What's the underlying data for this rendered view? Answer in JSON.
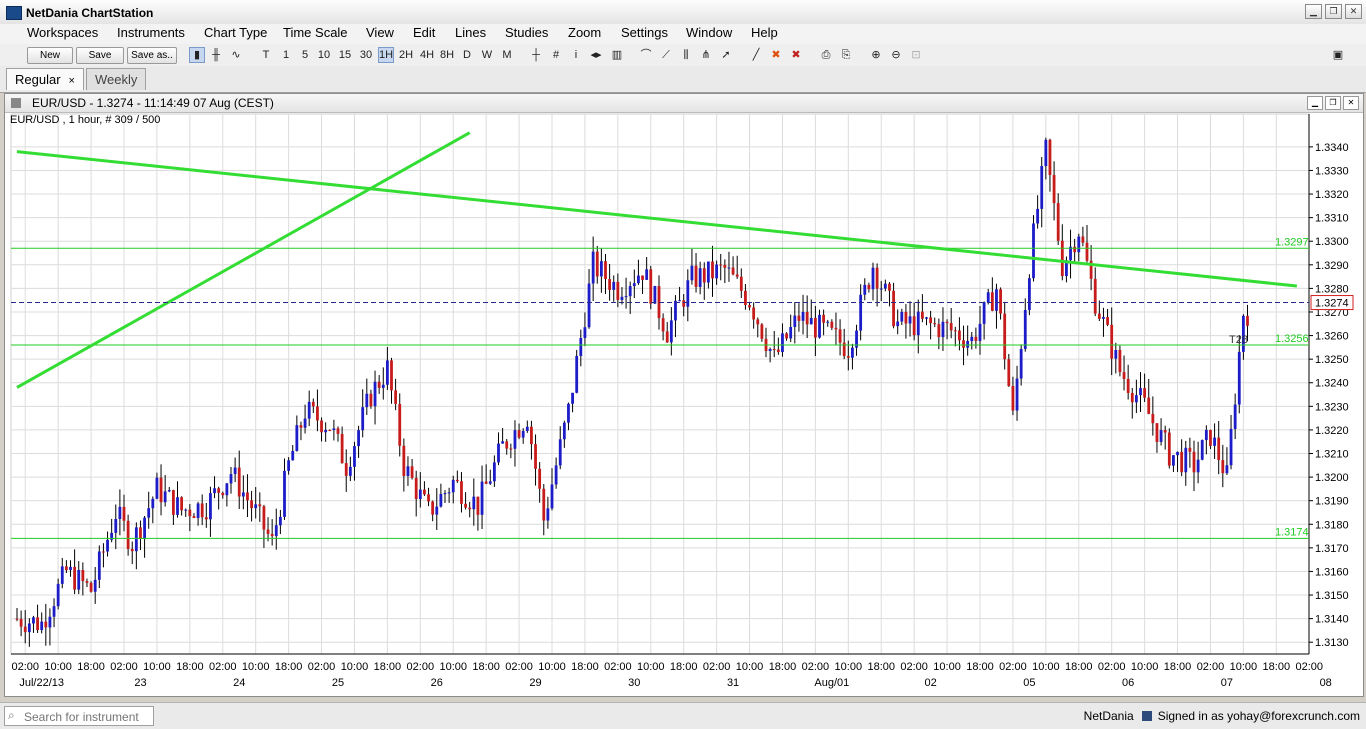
{
  "app": {
    "title": "NetDania ChartStation"
  },
  "menus": [
    "Workspaces",
    "Instruments",
    "Chart Type",
    "Time Scale",
    "View",
    "Edit",
    "Lines",
    "Studies",
    "Zoom",
    "Settings",
    "Window",
    "Help"
  ],
  "toolbar": {
    "new_label": "New",
    "save_label": "Save",
    "save_as_label": "Save as..",
    "timeframes": [
      "T",
      "1",
      "5",
      "10",
      "15",
      "30",
      "1H",
      "2H",
      "4H",
      "8H",
      "D",
      "W",
      "M"
    ],
    "selected_timeframe": "1H"
  },
  "tabs": [
    {
      "label": "Regular",
      "active": true,
      "close": "×"
    },
    {
      "label": "Weekly",
      "active": false
    }
  ],
  "chart_window": {
    "title": "EUR/USD - 1.3274 - 11:14:49  07 Aug (CEST)",
    "info": "EUR/USD , 1 hour, # 309 / 500"
  },
  "chart_data": {
    "type": "candlestick",
    "instrument": "EUR/USD",
    "interval": "1 hour",
    "last_price": 1.3274,
    "ylim": [
      1.3125,
      1.3348
    ],
    "y_ticks": [
      1.313,
      1.314,
      1.315,
      1.316,
      1.317,
      1.318,
      1.319,
      1.32,
      1.321,
      1.322,
      1.323,
      1.324,
      1.325,
      1.326,
      1.327,
      1.328,
      1.329,
      1.33,
      1.331,
      1.332,
      1.333,
      1.334
    ],
    "x_time_labels": [
      "02:00",
      "10:00",
      "18:00",
      "02:00",
      "10:00",
      "18:00",
      "02:00",
      "10:00",
      "18:00",
      "02:00",
      "10:00",
      "18:00",
      "02:00",
      "10:00",
      "18:00",
      "02:00",
      "10:00",
      "18:00",
      "02:00",
      "10:00",
      "18:00",
      "02:00",
      "10:00",
      "18:00",
      "02:00",
      "10:00",
      "18:00",
      "02:00",
      "10:00",
      "18:00",
      "02:00",
      "10:00",
      "18:00",
      "02:00",
      "10:00",
      "18:00",
      "02:00",
      "10:00",
      "18:00",
      "02:00"
    ],
    "x_date_labels": [
      "Jul/22/13",
      "23",
      "24",
      "25",
      "26",
      "29",
      "30",
      "31",
      "Aug/01",
      "02",
      "05",
      "06",
      "07",
      "08"
    ],
    "horizontal_lines": [
      {
        "value": 1.3297,
        "label": "1.3297",
        "color": "#22cc22"
      },
      {
        "value": 1.3256,
        "label": "1.3256",
        "color": "#22cc22"
      },
      {
        "value": 1.3174,
        "label": "1.3174",
        "color": "#22cc22"
      }
    ],
    "current_price_label": "1.3274",
    "annotation": "T28",
    "trend_lines": [
      {
        "from": {
          "x": "Jul/22 00:00",
          "y": 1.3338
        },
        "to": {
          "x": "Aug/07 23:00",
          "y": 1.3281
        }
      },
      {
        "from": {
          "x": "Jul/22 00:00",
          "y": 1.3238
        },
        "to": {
          "x": "Jul/26 14:00",
          "y": 1.3346
        }
      }
    ],
    "up_color": "#1c1cc8",
    "down_color": "#c81c1c",
    "trend_color": "#33dd33",
    "price_path": [
      {
        "t": "Jul/22 00:00",
        "p": 1.314
      },
      {
        "t": "Jul/22 06:00",
        "p": 1.3138
      },
      {
        "t": "Jul/22 12:00",
        "p": 1.316
      },
      {
        "t": "Jul/22 18:00",
        "p": 1.3152
      },
      {
        "t": "Jul/23 00:00",
        "p": 1.3185
      },
      {
        "t": "Jul/23 04:00",
        "p": 1.3172
      },
      {
        "t": "Jul/23 10:00",
        "p": 1.3195
      },
      {
        "t": "Jul/23 16:00",
        "p": 1.3186
      },
      {
        "t": "Jul/23 22:00",
        "p": 1.3188
      },
      {
        "t": "Jul/24 04:00",
        "p": 1.3202
      },
      {
        "t": "Jul/24 10:00",
        "p": 1.3185
      },
      {
        "t": "Jul/24 14:00",
        "p": 1.3172
      },
      {
        "t": "Jul/24 18:00",
        "p": 1.3205
      },
      {
        "t": "Jul/24 22:00",
        "p": 1.3228
      },
      {
        "t": "Jul/25 04:00",
        "p": 1.3222
      },
      {
        "t": "Jul/25 08:00",
        "p": 1.3205
      },
      {
        "t": "Jul/25 14:00",
        "p": 1.3235
      },
      {
        "t": "Jul/25 18:00",
        "p": 1.3246
      },
      {
        "t": "Jul/25 22:00",
        "p": 1.3205
      },
      {
        "t": "Jul/26 04:00",
        "p": 1.3185
      },
      {
        "t": "Jul/26 10:00",
        "p": 1.3198
      },
      {
        "t": "Jul/26 16:00",
        "p": 1.3188
      },
      {
        "t": "Jul/26 22:00",
        "p": 1.3213
      },
      {
        "t": "Jul/29 04:00",
        "p": 1.3226
      },
      {
        "t": "Jul/29 08:00",
        "p": 1.3182
      },
      {
        "t": "Jul/29 14:00",
        "p": 1.3228
      },
      {
        "t": "Jul/29 20:00",
        "p": 1.329
      },
      {
        "t": "Jul/30 02:00",
        "p": 1.328
      },
      {
        "t": "Jul/30 08:00",
        "p": 1.3288
      },
      {
        "t": "Jul/30 14:00",
        "p": 1.3262
      },
      {
        "t": "Jul/30 20:00",
        "p": 1.3284
      },
      {
        "t": "Jul/31 04:00",
        "p": 1.3288
      },
      {
        "t": "Jul/31 10:00",
        "p": 1.3275
      },
      {
        "t": "Jul/31 16:00",
        "p": 1.325
      },
      {
        "t": "Jul/31 22:00",
        "p": 1.3268
      },
      {
        "t": "Aug/01 04:00",
        "p": 1.3262
      },
      {
        "t": "Aug/01 10:00",
        "p": 1.3255
      },
      {
        "t": "Aug/01 16:00",
        "p": 1.329
      },
      {
        "t": "Aug/01 22:00",
        "p": 1.3265
      },
      {
        "t": "Aug/02 04:00",
        "p": 1.3265
      },
      {
        "t": "Aug/02 10:00",
        "p": 1.3263
      },
      {
        "t": "Aug/02 16:00",
        "p": 1.3258
      },
      {
        "t": "Aug/02 22:00",
        "p": 1.328
      },
      {
        "t": "Aug/05 02:00",
        "p": 1.3225
      },
      {
        "t": "Aug/05 06:00",
        "p": 1.329
      },
      {
        "t": "Aug/05 10:00",
        "p": 1.3338
      },
      {
        "t": "Aug/05 14:00",
        "p": 1.329
      },
      {
        "t": "Aug/05 18:00",
        "p": 1.3305
      },
      {
        "t": "Aug/05 22:00",
        "p": 1.3275
      },
      {
        "t": "Aug/06 04:00",
        "p": 1.3245
      },
      {
        "t": "Aug/06 10:00",
        "p": 1.323
      },
      {
        "t": "Aug/06 16:00",
        "p": 1.321
      },
      {
        "t": "Aug/06 22:00",
        "p": 1.3205
      },
      {
        "t": "Aug/07 02:00",
        "p": 1.3218
      },
      {
        "t": "Aug/07 06:00",
        "p": 1.32
      },
      {
        "t": "Aug/07 10:00",
        "p": 1.327
      }
    ]
  },
  "status": {
    "search_placeholder": "Search for instrument",
    "brand": "NetDania",
    "signed_in": "Signed in as yohay@forexcrunch.com"
  }
}
